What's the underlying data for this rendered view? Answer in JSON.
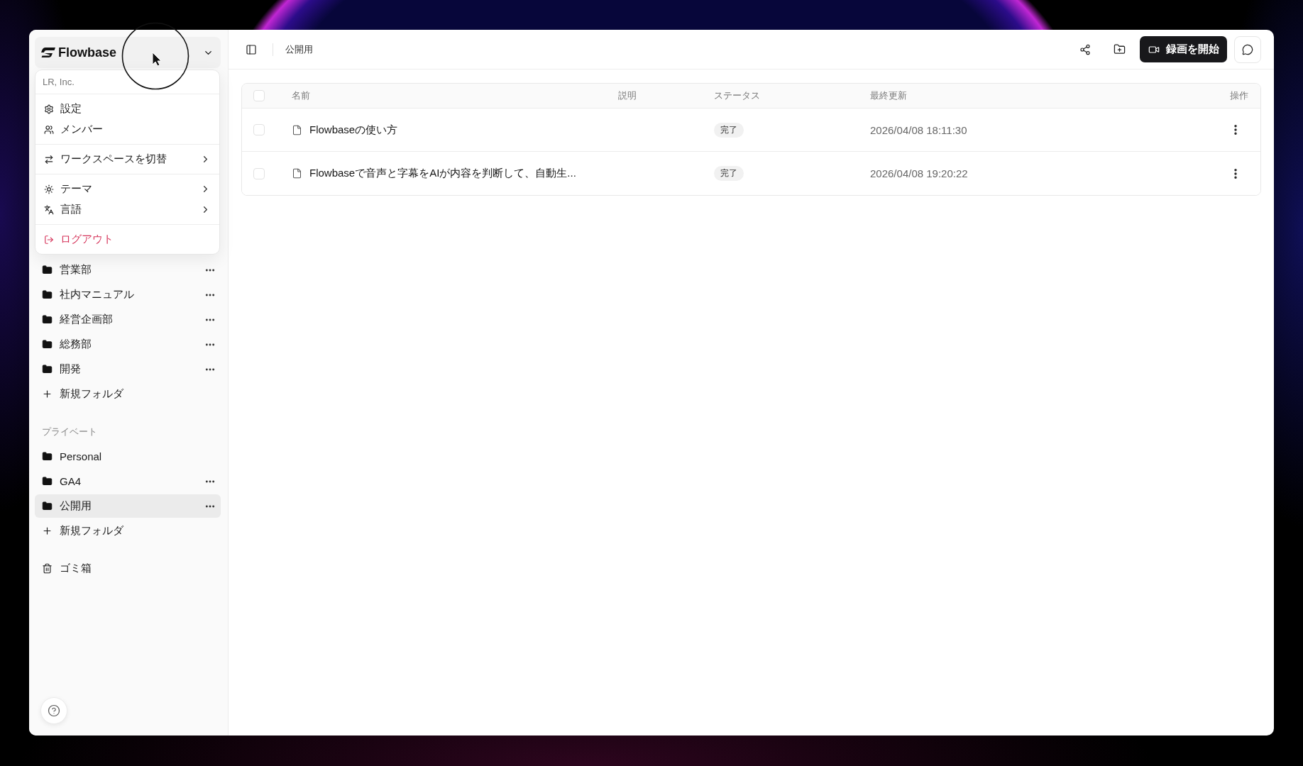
{
  "sidebar": {
    "brand": "Flowbase",
    "account_menu": {
      "organization": "LR, Inc.",
      "groups": [
        {
          "items": [
            {
              "kind": "item",
              "label": "設定"
            },
            {
              "kind": "item",
              "label": "メンバー"
            }
          ]
        },
        {
          "items": [
            {
              "kind": "submenu",
              "label": "ワークスペースを切替"
            }
          ]
        },
        {
          "items": [
            {
              "kind": "submenu",
              "label": "テーマ"
            },
            {
              "kind": "submenu",
              "label": "言語"
            }
          ]
        },
        {
          "items": [
            {
              "kind": "danger",
              "label": "ログアウト"
            }
          ]
        }
      ]
    },
    "sections": [
      {
        "folders": [
          {
            "label": "営業部",
            "has_menu": true,
            "selected": false
          },
          {
            "label": "社内マニュアル",
            "has_menu": true,
            "selected": false
          },
          {
            "label": "経営企画部",
            "has_menu": true,
            "selected": false
          },
          {
            "label": "総務部",
            "has_menu": true,
            "selected": false
          },
          {
            "label": "開発",
            "has_menu": true,
            "selected": false
          }
        ],
        "new_folder": "新規フォルダ"
      },
      {
        "title": "プライベート",
        "folders": [
          {
            "label": "Personal",
            "has_menu": false,
            "selected": false
          },
          {
            "label": "GA4",
            "has_menu": true,
            "selected": false
          },
          {
            "label": "公開用",
            "has_menu": true,
            "selected": true
          }
        ],
        "new_folder": "新規フォルダ"
      }
    ],
    "trash": "ゴミ箱"
  },
  "topbar": {
    "breadcrumb": "公開用",
    "record_button": "録画を開始"
  },
  "table": {
    "select_all": {
      "checked": false
    },
    "columns": [
      "名前",
      "説明",
      "ステータス",
      "最終更新",
      "操作"
    ],
    "rows": [
      {
        "checked": false,
        "name": "Flowbaseの使い方",
        "status": "完了",
        "updated": "2026/04/08 18:11:30"
      },
      {
        "checked": false,
        "name": "Flowbaseで音声と字幕をAIが内容を判断して、自動生...",
        "status": "完了",
        "updated": "2026/04/08 19:20:22"
      }
    ]
  }
}
